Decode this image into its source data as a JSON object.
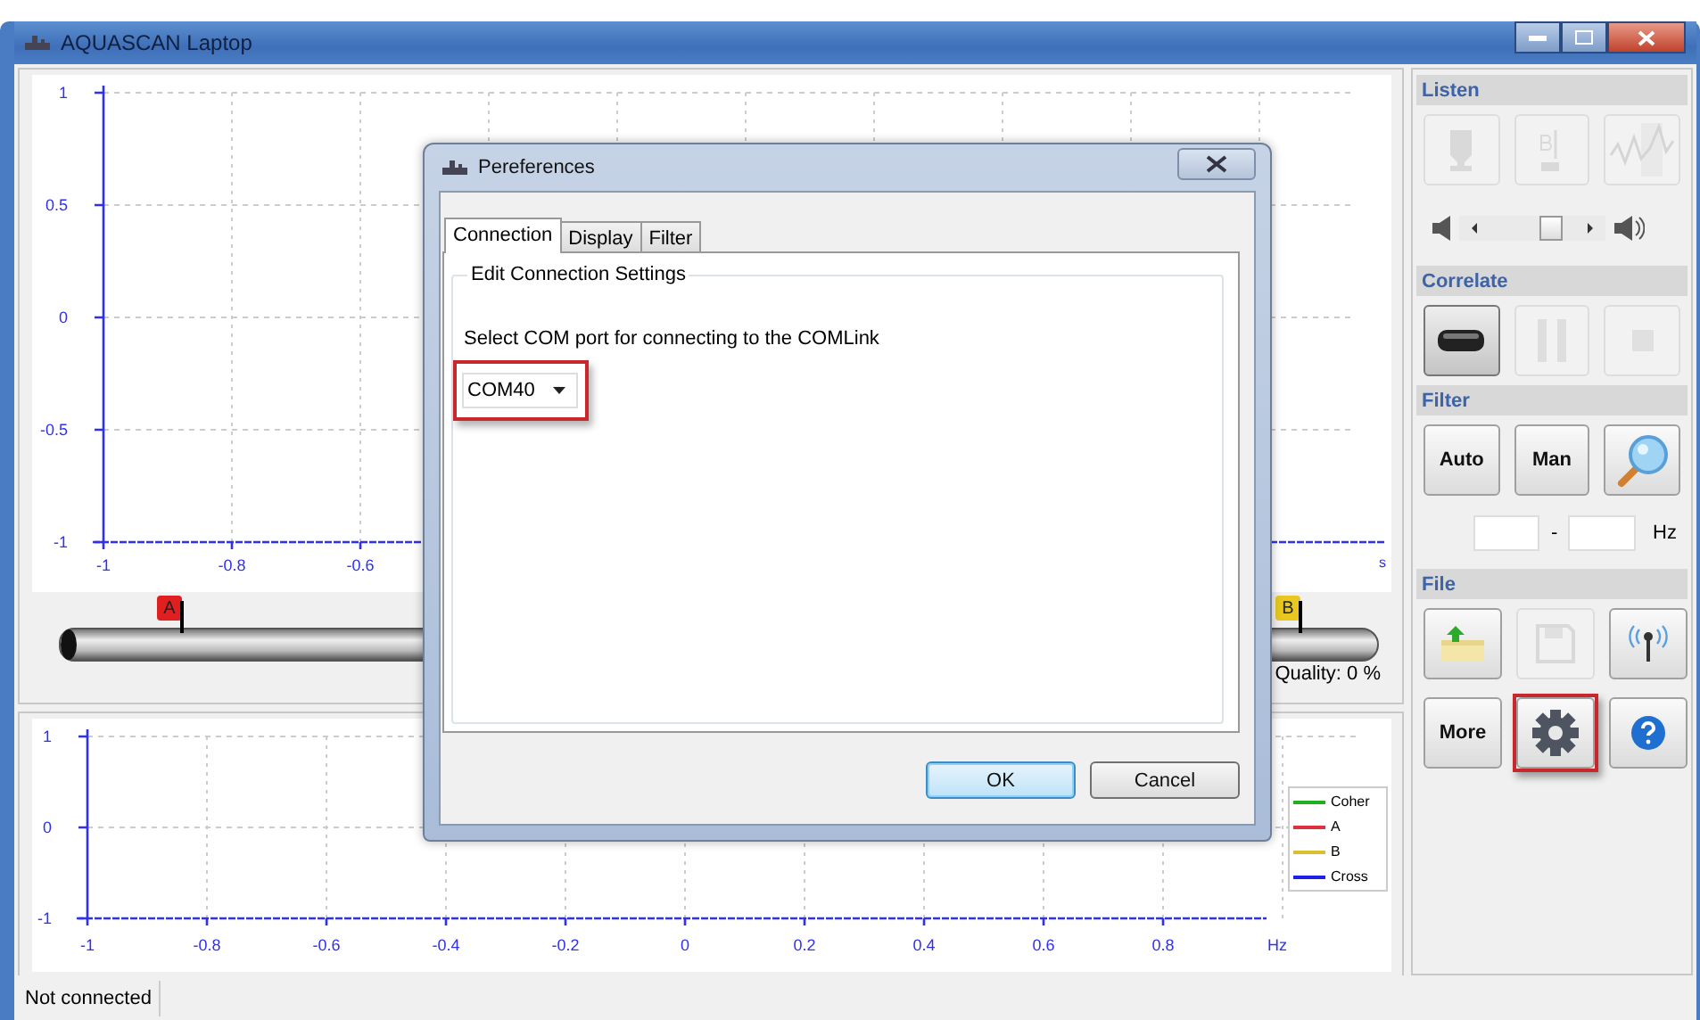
{
  "window": {
    "title": "AQUASCAN Laptop"
  },
  "time_plot": {
    "y_ticks": [
      "1",
      "0.5",
      "0",
      "-0.5",
      "-1"
    ],
    "x_ticks": [
      "-1",
      "-0.8",
      "-0.6"
    ],
    "x_unit": "s"
  },
  "pipe": {
    "markers": [
      {
        "label": "A",
        "color": "#e02020"
      },
      {
        "label": "B",
        "color": "#e8c820"
      }
    ],
    "quality": "Quality: 0 %"
  },
  "spectrum_plot": {
    "y_ticks": [
      "1",
      "0",
      "-1"
    ],
    "x_ticks": [
      "-1",
      "-0.8",
      "-0.6",
      "-0.4",
      "-0.2",
      "0",
      "0.2",
      "0.4",
      "0.6",
      "0.8"
    ],
    "x_unit": "Hz",
    "legend": [
      {
        "label": "Coher",
        "color": "#20b020"
      },
      {
        "label": "A",
        "color": "#e03040"
      },
      {
        "label": "B",
        "color": "#d8c030"
      },
      {
        "label": "Cross",
        "color": "#2020e8"
      }
    ]
  },
  "listen": {
    "title": "Listen",
    "buttons": [
      {
        "kind": "channel_a",
        "disabled": true
      },
      {
        "kind": "channel_b",
        "disabled": true
      },
      {
        "kind": "waveform",
        "disabled": true
      }
    ],
    "volume": {
      "level": 0.62
    }
  },
  "correlate": {
    "title": "Correlate",
    "buttons": [
      {
        "kind": "play",
        "disabled": false
      },
      {
        "kind": "pause",
        "disabled": true
      },
      {
        "kind": "stop",
        "disabled": true
      }
    ]
  },
  "filter": {
    "title": "Filter",
    "buttons": [
      {
        "kind": "text",
        "label": "Auto",
        "disabled": false
      },
      {
        "kind": "text",
        "label": "Man",
        "disabled": false
      },
      {
        "kind": "search",
        "disabled": false
      }
    ],
    "range_separator": "-",
    "range_unit": "Hz"
  },
  "file": {
    "title": "File",
    "buttons": [
      {
        "kind": "open",
        "disabled": false,
        "highlighted": false
      },
      {
        "kind": "save",
        "disabled": true,
        "highlighted": false
      },
      {
        "kind": "wireless",
        "disabled": false,
        "highlighted": false
      },
      {
        "kind": "text",
        "label": "More",
        "disabled": false,
        "highlighted": false
      },
      {
        "kind": "settings",
        "disabled": false,
        "highlighted": true
      },
      {
        "kind": "help",
        "disabled": false,
        "highlighted": false
      }
    ]
  },
  "dialog": {
    "title": "Pereferences",
    "tabs": [
      {
        "label": "Connection",
        "selected": true
      },
      {
        "label": "Display",
        "selected": false
      },
      {
        "label": "Filter",
        "selected": false
      }
    ],
    "group_title": "Edit Connection Settings",
    "prompt": "Select COM port for connecting to the COMLink",
    "port": {
      "value": "COM40",
      "highlighted": true
    },
    "buttons": [
      {
        "label": "OK",
        "default": true
      },
      {
        "label": "Cancel",
        "default": false
      }
    ]
  },
  "status_bar": {
    "text": "Not connected"
  }
}
